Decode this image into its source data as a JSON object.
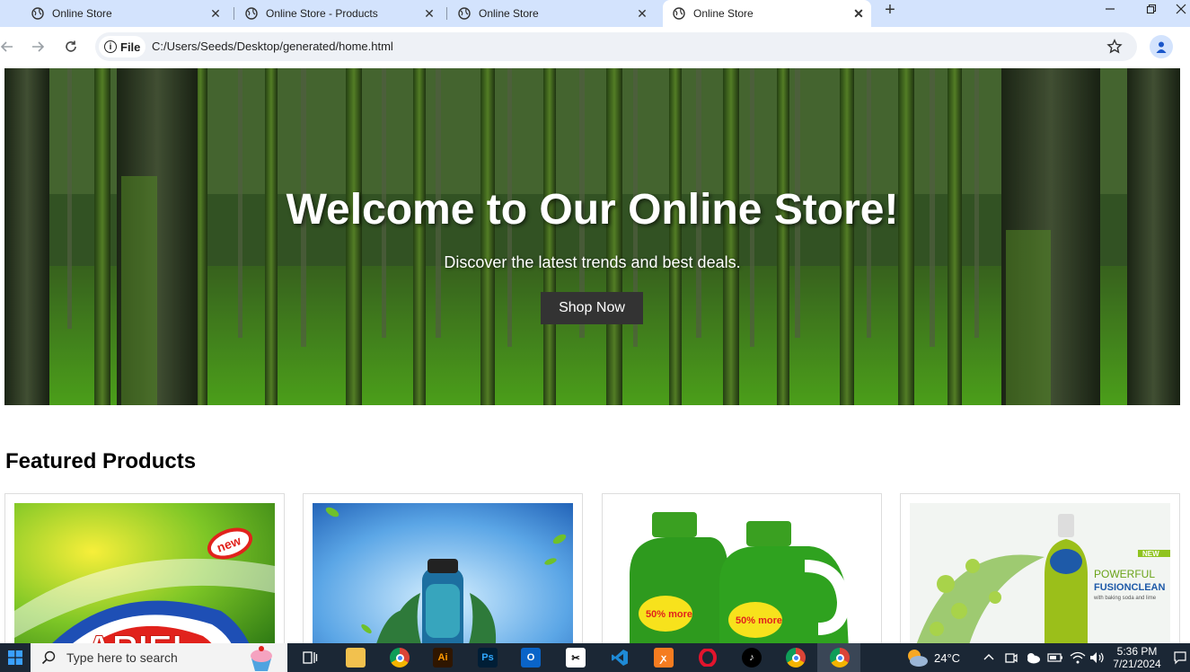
{
  "browser": {
    "tabs": [
      {
        "title": "Online Store",
        "active": false
      },
      {
        "title": "Online Store - Products",
        "active": false
      },
      {
        "title": "Online Store",
        "active": false
      },
      {
        "title": "Online Store",
        "active": true
      }
    ],
    "new_tab_symbol": "+",
    "url_chip_label": "File",
    "url": "C:/Users/Seeds/Desktop/generated/home.html"
  },
  "hero": {
    "title": "Welcome to Our Online Store!",
    "subtitle": "Discover the latest trends and best deals.",
    "cta_label": "Shop Now"
  },
  "featured": {
    "title": "Featured Products",
    "products": [
      {
        "image_name": "orange-detergent-box-image",
        "badge": "new"
      },
      {
        "image_name": "blue-bottle-leaves-image"
      },
      {
        "image_name": "green-detergent-bottles-image",
        "badge": "50% more"
      },
      {
        "image_name": "dish-soap-bottle-image",
        "badge": "NEW",
        "caption_line1": "POWERFUL",
        "caption_line2": "FUSIONCLEAN",
        "caption_line3": "with baking soda and lime"
      }
    ]
  },
  "taskbar": {
    "search_placeholder": "Type here to search",
    "weather": "24°C",
    "time": "5:36 PM",
    "date": "7/21/2024"
  },
  "colors": {
    "tabstrip": "#d3e3fd",
    "taskbar": "#1b2735",
    "cta_bg": "#333333"
  }
}
